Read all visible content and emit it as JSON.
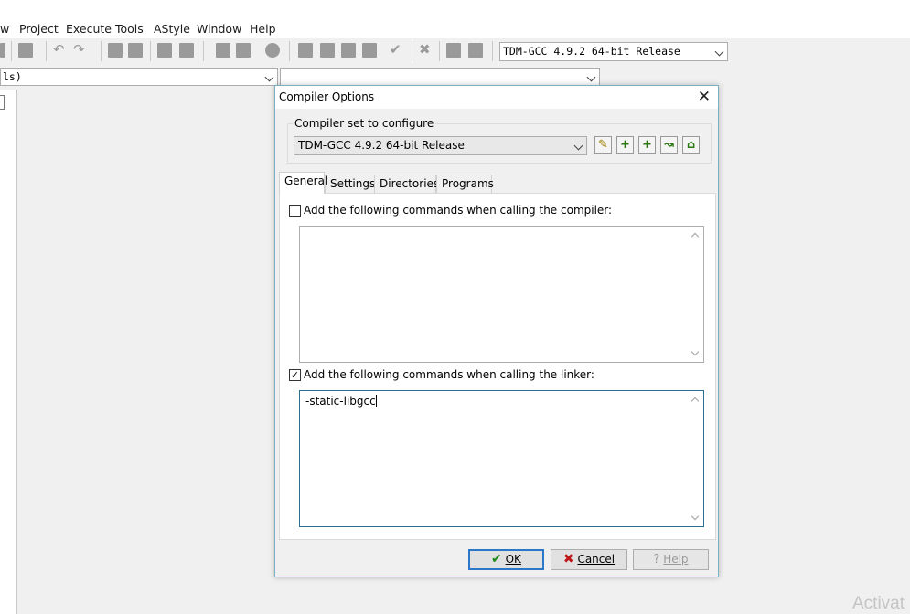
{
  "menubar": {
    "items": [
      "w",
      "Project",
      "Execute",
      "Tools",
      "AStyle",
      "Window",
      "Help"
    ]
  },
  "toolbar": {
    "compiler_combo_value": "TDM-GCC 4.9.2 64-bit Release"
  },
  "row2": {
    "left_combo_value": "ls)",
    "right_combo_value": ""
  },
  "dialog": {
    "title": "Compiler Options",
    "close_glyph": "✕",
    "compiler_set_label": "Compiler set to configure",
    "compiler_set_value": "TDM-GCC 4.9.2 64-bit Release",
    "tabs": [
      "General",
      "Settings",
      "Directories",
      "Programs"
    ],
    "compiler_cmd_label": "Add the following commands when calling the compiler:",
    "compiler_cmd_checked": false,
    "compiler_cmd_text": "",
    "linker_cmd_label": "Add the following commands when calling the linker:",
    "linker_cmd_checked": true,
    "linker_cmd_text": "-static-libgcc",
    "buttons": {
      "ok": "OK",
      "cancel": "Cancel",
      "help": "Help"
    }
  },
  "watermark": "Activat"
}
